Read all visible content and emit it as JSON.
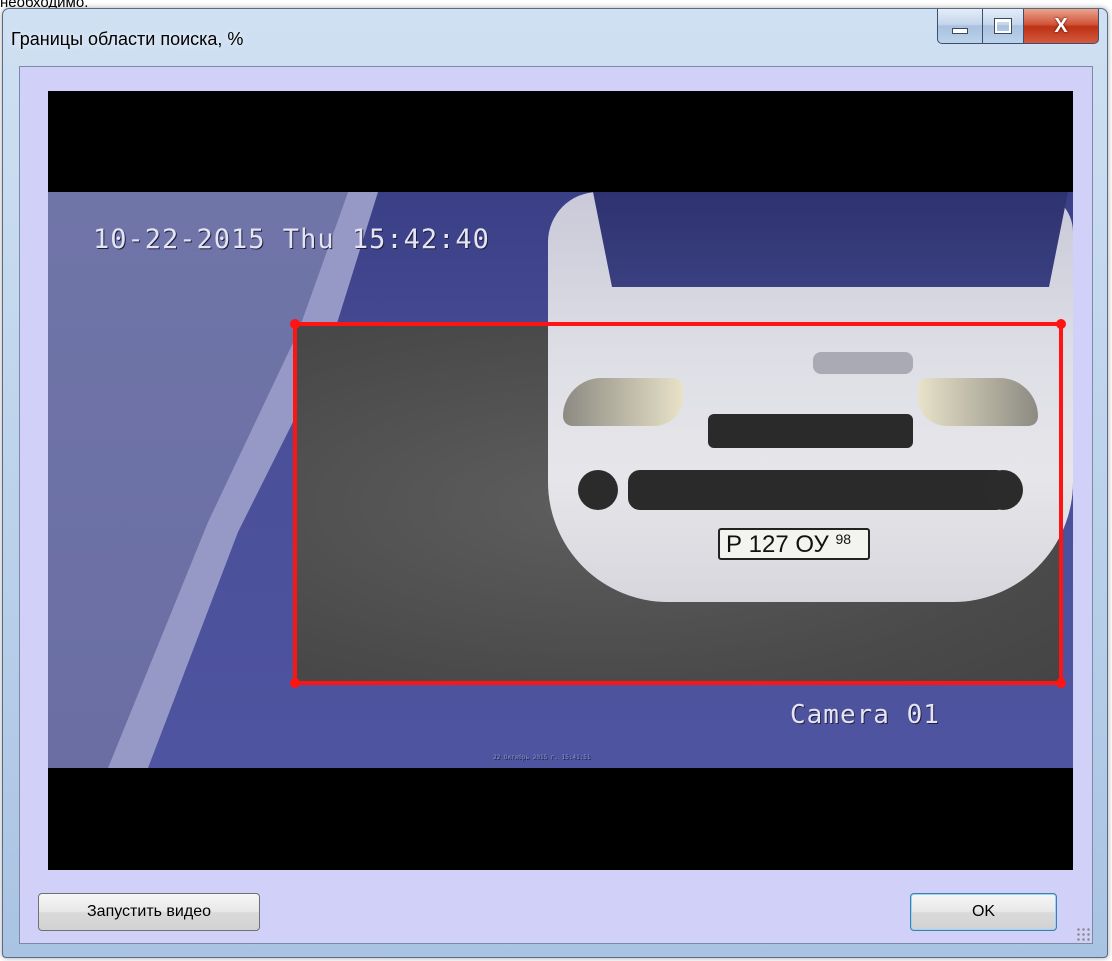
{
  "top_text": "необходимо.",
  "window": {
    "title": "Границы области поиска, %",
    "close_label": "X"
  },
  "video": {
    "timestamp": "10-22-2015 Thu 15:42:40",
    "camera_label": "Camera 01",
    "small_caption": "22 Октябрь 2015 г. 15:41:51",
    "plate_main": "Р 127 ОУ",
    "plate_region": "98"
  },
  "buttons": {
    "start_video": "Запустить видео",
    "ok": "OK"
  },
  "colors": {
    "roi_frame": "#ff1414",
    "client_bg": "#d0d0f8"
  }
}
